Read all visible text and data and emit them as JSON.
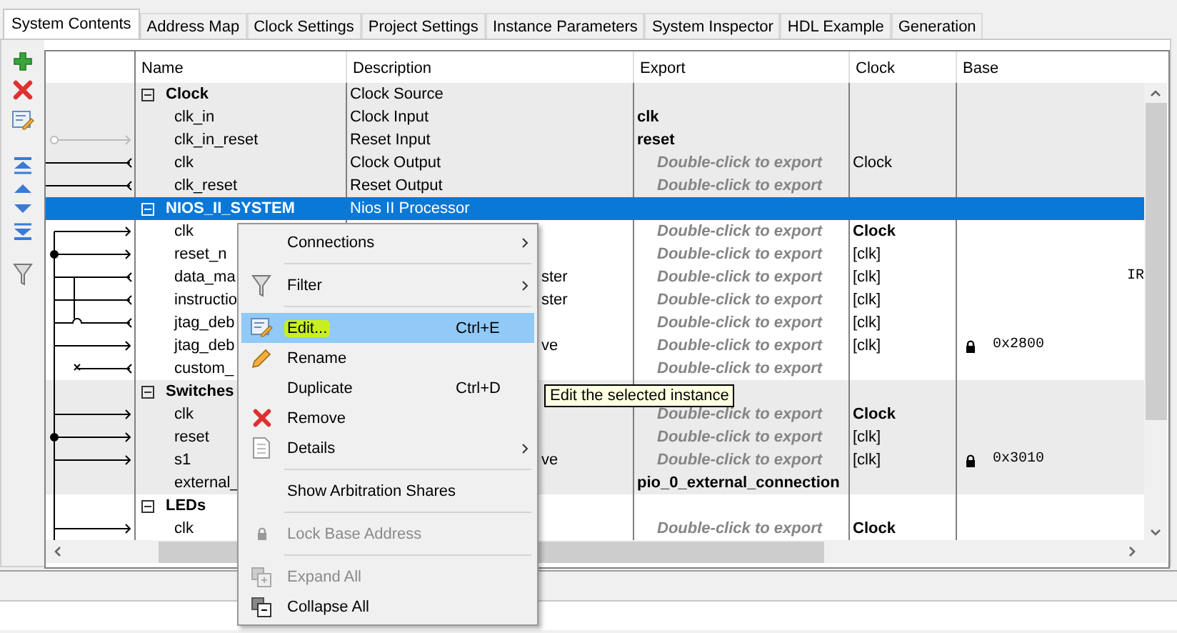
{
  "tabs": [
    {
      "label": "System Contents",
      "selected": true
    },
    {
      "label": "Address Map",
      "selected": false
    },
    {
      "label": "Clock Settings",
      "selected": false
    },
    {
      "label": "Project Settings",
      "selected": false
    },
    {
      "label": "Instance Parameters",
      "selected": false
    },
    {
      "label": "System Inspector",
      "selected": false
    },
    {
      "label": "HDL Example",
      "selected": false
    },
    {
      "label": "Generation",
      "selected": false
    }
  ],
  "table": {
    "columns": [
      "Name",
      "Description",
      "Export",
      "Clock",
      "Base"
    ],
    "groups": [
      {
        "name": "Clock",
        "description": "Clock Source",
        "expanded": true,
        "selected": false,
        "children": [
          {
            "name": "clk_in",
            "description": "Clock Input",
            "export": "clk",
            "exported": true
          },
          {
            "name": "clk_in_reset",
            "description": "Reset Input",
            "export": "reset",
            "exported": true
          },
          {
            "name": "clk",
            "description": "Clock Output",
            "export": "Double-click to export",
            "exported": false,
            "clock": "Clock",
            "clock_bold": false
          },
          {
            "name": "clk_reset",
            "description": "Reset Output",
            "export": "Double-click to export",
            "exported": false
          }
        ]
      },
      {
        "name": "NIOS_II_SYSTEM",
        "description": "Nios II Processor",
        "expanded": true,
        "selected": true,
        "children": [
          {
            "name": "clk",
            "export": "Double-click to export",
            "exported": false,
            "clock": "Clock",
            "clock_bold": true
          },
          {
            "name": "reset_n",
            "export": "Double-click to export",
            "exported": false,
            "clock": "[clk]",
            "clock_bold": false
          },
          {
            "name": "data_ma",
            "description_tail": "ster",
            "export": "Double-click to export",
            "exported": false,
            "clock": "[clk]",
            "clock_bold": false,
            "column_6": "IR"
          },
          {
            "name": "instructio",
            "description_tail": "ster",
            "export": "Double-click to export",
            "exported": false,
            "clock": "[clk]",
            "clock_bold": false
          },
          {
            "name": "jtag_deb",
            "export": "Double-click to export",
            "exported": false,
            "clock": "[clk]",
            "clock_bold": false
          },
          {
            "name": "jtag_deb",
            "description_tail": "ve",
            "export": "Double-click to export",
            "exported": false,
            "clock": "[clk]",
            "clock_bold": false,
            "base": "0x2800",
            "locked": true
          },
          {
            "name": "custom_",
            "export": "Double-click to export",
            "exported": false
          }
        ]
      },
      {
        "name": "Switches",
        "expanded": true,
        "selected": false,
        "children": [
          {
            "name": "clk",
            "export": "Double-click to export",
            "exported": false,
            "clock": "Clock",
            "clock_bold": true
          },
          {
            "name": "reset",
            "export": "Double-click to export",
            "exported": false,
            "clock": "[clk]",
            "clock_bold": false
          },
          {
            "name": "s1",
            "description_tail": "ve",
            "export": "Double-click to export",
            "exported": false,
            "clock": "[clk]",
            "clock_bold": false,
            "base": "0x3010",
            "locked": true
          },
          {
            "name": "external_",
            "export": "pio_0_external_connection",
            "exported": true
          }
        ]
      },
      {
        "name": "LEDs",
        "expanded": true,
        "selected": false,
        "children": [
          {
            "name": "clk",
            "export": "Double-click to export",
            "exported": false,
            "clock": "Clock",
            "clock_bold": true
          }
        ]
      }
    ]
  },
  "context_menu": {
    "sections": [
      [
        {
          "label": "Connections",
          "submenu": true,
          "disabled": false,
          "selected": false,
          "marked": false
        }
      ],
      [
        {
          "label": "Filter",
          "submenu": true,
          "disabled": false,
          "selected": false,
          "marked": false
        }
      ],
      [
        {
          "label": "Edit...",
          "shortcut": "Ctrl+E",
          "submenu": false,
          "disabled": false,
          "selected": true,
          "marked": true
        },
        {
          "label": "Rename",
          "submenu": false,
          "disabled": false,
          "selected": false,
          "marked": false
        },
        {
          "label": "Duplicate",
          "shortcut": "Ctrl+D",
          "submenu": false,
          "disabled": false,
          "selected": false,
          "marked": false
        },
        {
          "label": "Remove",
          "submenu": false,
          "disabled": false,
          "selected": false,
          "marked": false
        },
        {
          "label": "Details",
          "submenu": true,
          "disabled": false,
          "selected": false,
          "marked": false
        }
      ],
      [
        {
          "label": "Show Arbitration Shares",
          "submenu": false,
          "disabled": false,
          "selected": false,
          "marked": false
        }
      ],
      [
        {
          "label": "Lock Base Address",
          "submenu": false,
          "disabled": true,
          "selected": false,
          "marked": false
        }
      ],
      [
        {
          "label": "Expand All",
          "submenu": false,
          "disabled": true,
          "selected": false,
          "marked": false
        },
        {
          "label": "Collapse All",
          "submenu": false,
          "disabled": false,
          "selected": false,
          "marked": false
        }
      ]
    ]
  },
  "tooltip": {
    "text": "Edit the selected instance"
  }
}
